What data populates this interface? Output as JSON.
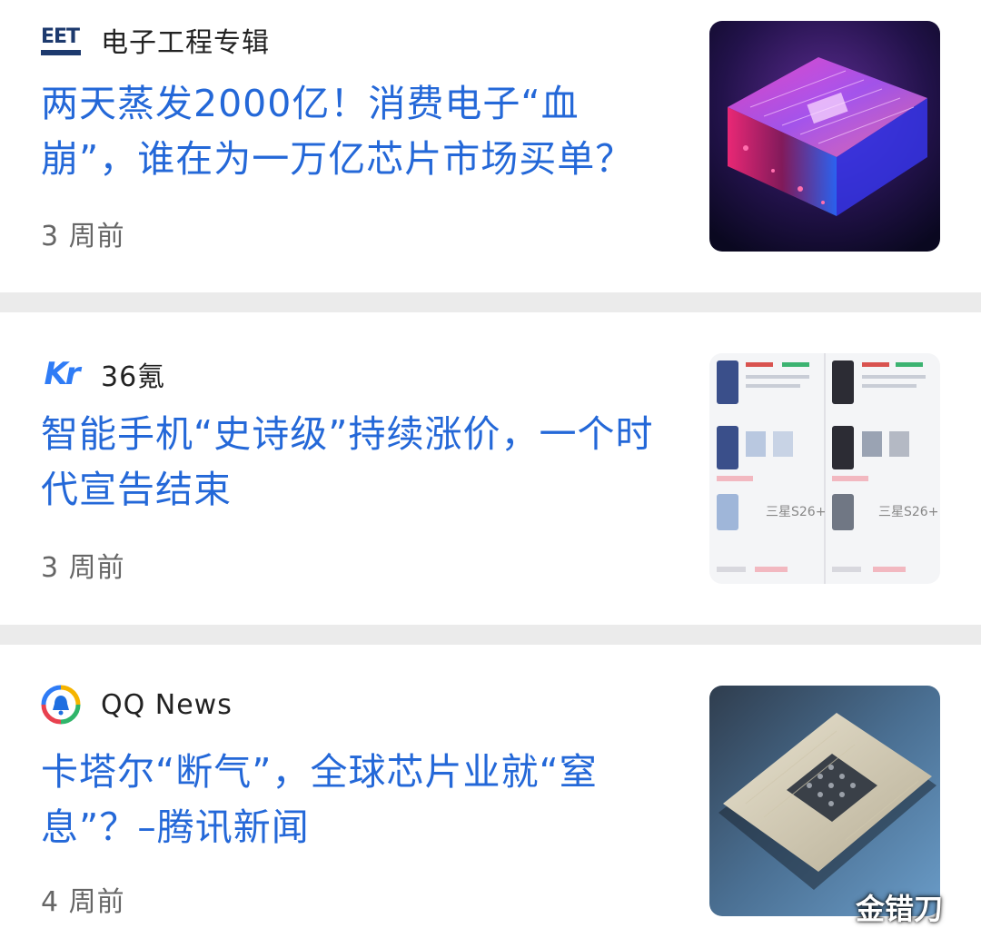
{
  "feed": {
    "items": [
      {
        "source_name": "电子工程专辑",
        "source_logo_icon": "eet-logo-icon",
        "logo_text": "EET",
        "title": "两天蒸发2000亿！消费电子“血崩”，谁在为一万亿芯片市场买单？",
        "age": "3 周前",
        "thumbnail_icon": "glowing-chip-image"
      },
      {
        "source_name": "36氪",
        "source_logo_icon": "36kr-logo-icon",
        "logo_text": "Kr",
        "title": "智能手机“史诗级”持续涨价，一个时代宣告结束",
        "age": "3 周前",
        "thumbnail_icon": "phone-price-screenshot-image",
        "thumbnail_labels": [
          "三星S26+",
          "三星S26+"
        ]
      },
      {
        "source_name": "QQ News",
        "source_logo_icon": "qq-news-logo-icon",
        "title": "卡塔尔“断气”，全球芯片业就“窒息”？–腾讯新闻",
        "age": "4 周前",
        "thumbnail_icon": "cpu-chip-image"
      }
    ]
  },
  "watermark": "金错刀",
  "colors": {
    "title": "#2468d8",
    "source": "#222222",
    "age": "#666666",
    "separator": "#ebebeb",
    "kr_blue": "#2f7cf6"
  }
}
